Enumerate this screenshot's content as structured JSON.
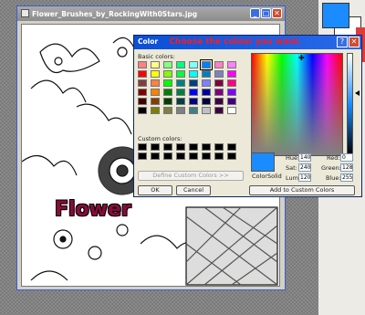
{
  "image_window": {
    "title": "Flower_Brushes_by_RockingWith0Stars.jpg",
    "btn_min": "_",
    "btn_max": "□",
    "btn_close": "✕",
    "overlay_text": "Flower"
  },
  "dialog": {
    "title": "Color",
    "instruction": "Choose the colour you want.",
    "help": "?",
    "close": "✕",
    "basic_label": "Basic colors:",
    "custom_label": "Custom colors:",
    "define_btn": "Define Custom Colors >>",
    "ok": "OK",
    "cancel": "Cancel",
    "add_btn": "Add to Custom Colors",
    "color_solid": "Color|Solid",
    "hue_label": "Hue:",
    "hue": "140",
    "sat_label": "Sat:",
    "sat": "240",
    "lum_label": "Lum:",
    "lum": "120",
    "red_label": "Red:",
    "red": "0",
    "green_label": "Green:",
    "green": "128",
    "blue_label": "Blue:",
    "blue": "255",
    "basic_colors": [
      "#ff8080",
      "#ffff80",
      "#80ff80",
      "#00ff80",
      "#80ffff",
      "#0080ff",
      "#ff80c0",
      "#ff80ff",
      "#ff0000",
      "#ffff00",
      "#80ff00",
      "#00ff40",
      "#00ffff",
      "#0080c0",
      "#8080c0",
      "#ff00ff",
      "#804040",
      "#ff8040",
      "#00ff00",
      "#008080",
      "#004080",
      "#8080ff",
      "#800040",
      "#ff0080",
      "#800000",
      "#ff8000",
      "#008000",
      "#008040",
      "#0000ff",
      "#0000a0",
      "#800080",
      "#8000ff",
      "#400000",
      "#804000",
      "#004000",
      "#004040",
      "#000080",
      "#000040",
      "#400040",
      "#400080",
      "#000000",
      "#808000",
      "#808040",
      "#808080",
      "#408080",
      "#c0c0c0",
      "#400040",
      "#ffffff"
    ],
    "selected_index": 5,
    "selected_color": "#1a8cff"
  },
  "palette": {
    "foreground": "#1a8cff",
    "background": "#ffffff"
  }
}
